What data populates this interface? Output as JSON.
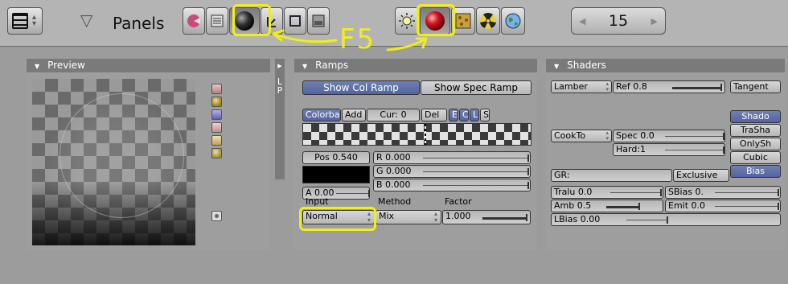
{
  "header": {
    "panels_label": "Panels",
    "frame": "15",
    "annotation": "F5"
  },
  "preview": {
    "title": "Preview"
  },
  "side_tab": "LP",
  "ramps": {
    "title": "Ramps",
    "show_col_ramp": "Show Col Ramp",
    "show_spec_ramp": "Show Spec Ramp",
    "colorband": "Colorban",
    "add": "Add",
    "cur": "Cur: 0",
    "del": "Del",
    "e": "E",
    "c": "C",
    "l": "L",
    "s": "S",
    "pos": "Pos 0.540",
    "r": "R 0.000",
    "g": "G 0.000",
    "a": "A 0.00",
    "b": "B 0.000",
    "input_label": "Input",
    "method_label": "Method",
    "factor_label": "Factor",
    "input_value": "Normal",
    "method_value": "Mix",
    "factor_value": "1.000"
  },
  "shaders": {
    "title": "Shaders",
    "lamber": "Lamber",
    "ref": "Ref  0.8",
    "tangent": "Tangent",
    "shado": "Shado",
    "trasha": "TraSha",
    "onlysh": "OnlySh",
    "cubic": "Cubic",
    "bias": "Bias",
    "cookto": "CookTo",
    "spec": "Spec 0.0",
    "hard": "Hard:1",
    "gr": "GR:",
    "exclusive": "Exclusive",
    "tralu": "Tralu 0.0",
    "sbias": "SBias 0.",
    "amb": "Amb 0.5",
    "emit": "Emit 0.0",
    "lbias": "LBias 0.00"
  }
}
